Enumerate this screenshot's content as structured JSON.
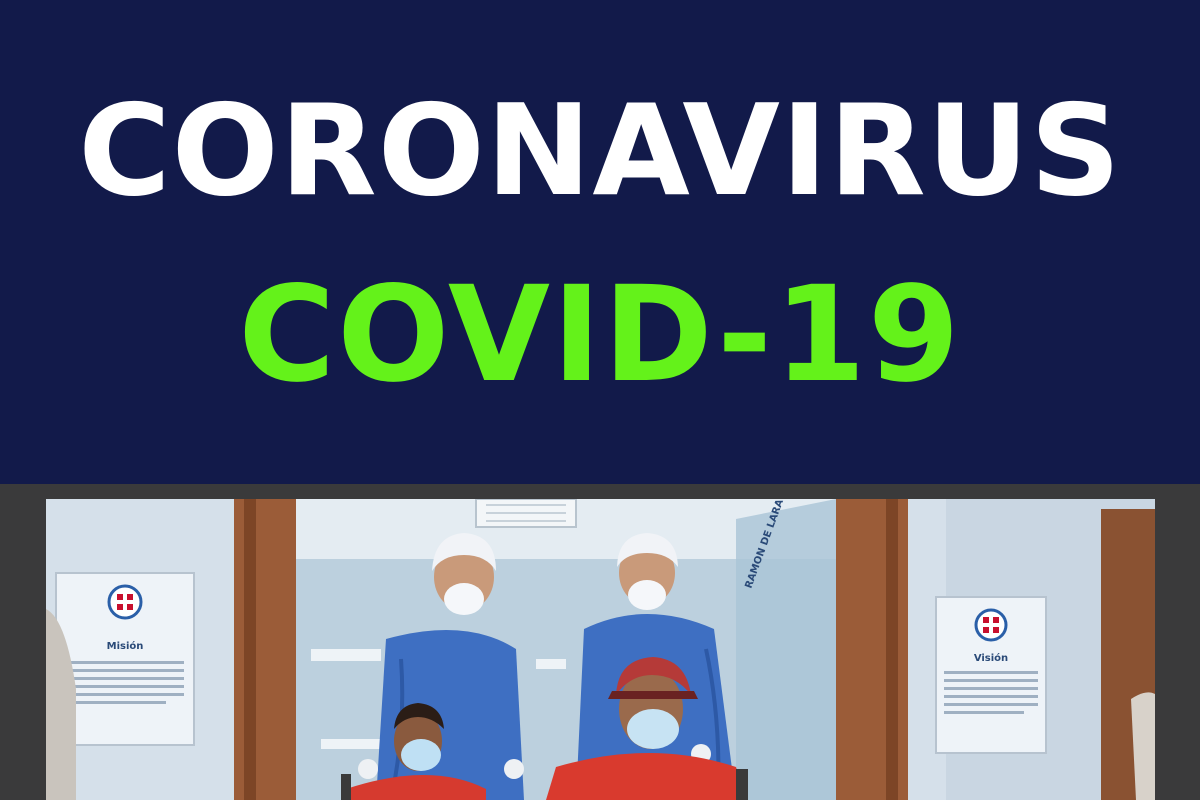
{
  "banner": {
    "line1": "CORONAVIRUS",
    "line2": "COVID-19",
    "background_color": "#121a4a",
    "line1_color": "#ffffff",
    "line2_color": "#64f21a"
  },
  "photo": {
    "left_sign_title": "Misión",
    "right_sign_title": "Visión"
  }
}
